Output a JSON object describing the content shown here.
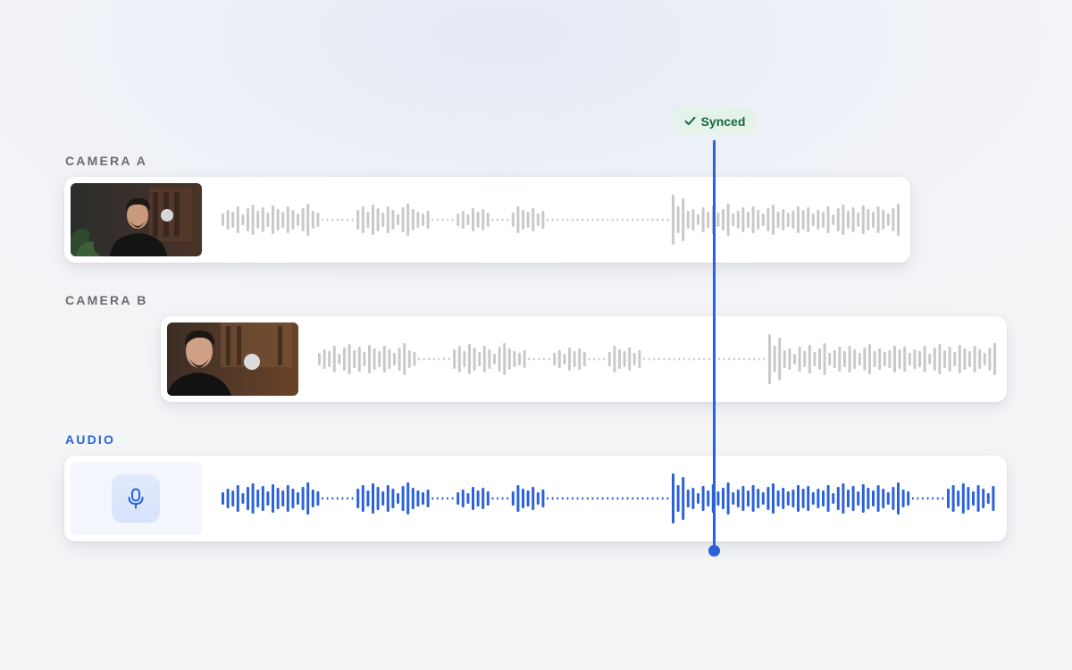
{
  "tracks": {
    "camera_a": {
      "label": "CAMERA A"
    },
    "camera_b": {
      "label": "CAMERA B"
    },
    "audio": {
      "label": "AUDIO"
    }
  },
  "sync_badge": {
    "label": "Synced",
    "icon": "check-icon"
  },
  "colors": {
    "accent": "#2c62d8",
    "waveform_inactive": "#c9c9cb",
    "waveform_audio": "#2c62d8",
    "synced_text": "#16683c",
    "synced_bg": "#e2f3e8"
  },
  "icons": {
    "audio": "microphone-icon"
  }
}
